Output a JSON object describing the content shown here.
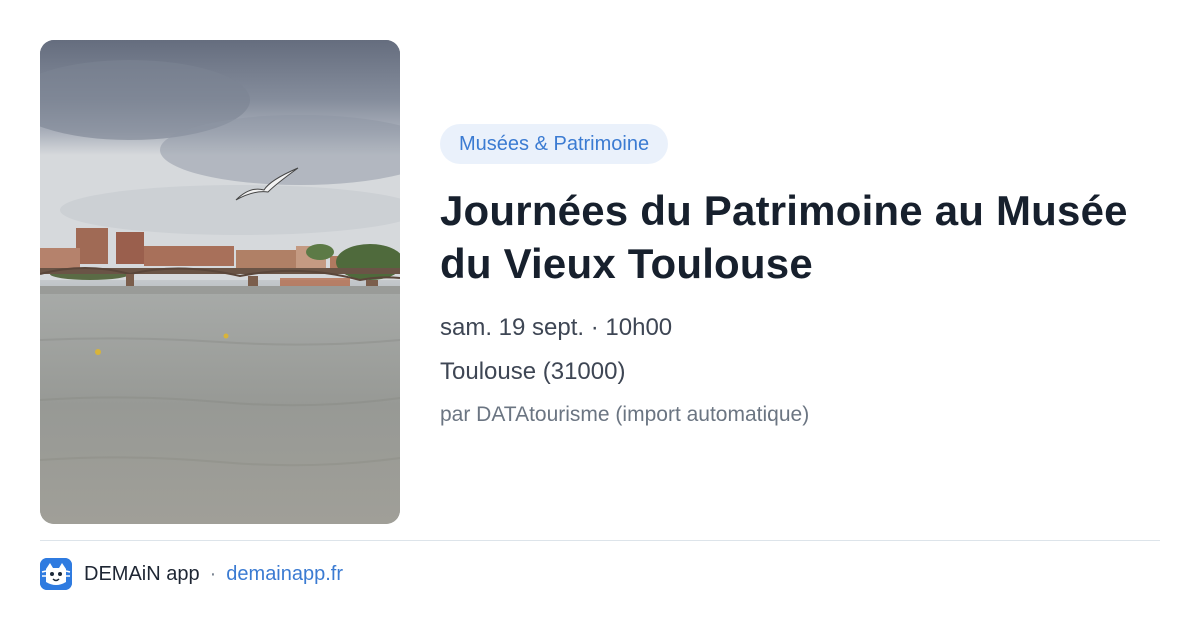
{
  "event": {
    "category": "Musées & Patrimoine",
    "title": "Journées du Patrimoine au Musée du Vieux Toulouse",
    "datetime": "sam. 19 sept. · 10h00",
    "location": "Toulouse (31000)",
    "source": "par DATAtourisme (import automatique)",
    "image_icon": "river-photo-icon"
  },
  "footer": {
    "app_name": "DEMAiN app",
    "separator": "·",
    "domain": "demainapp.fr",
    "logo_icon": "demain-app-logo-icon"
  },
  "colors": {
    "accent": "#3b7bd2",
    "category_bg": "#eaf1fb",
    "title": "#17202d",
    "meta": "#3e4654",
    "muted": "#6b7582",
    "logo_bg": "#2f7be0"
  }
}
